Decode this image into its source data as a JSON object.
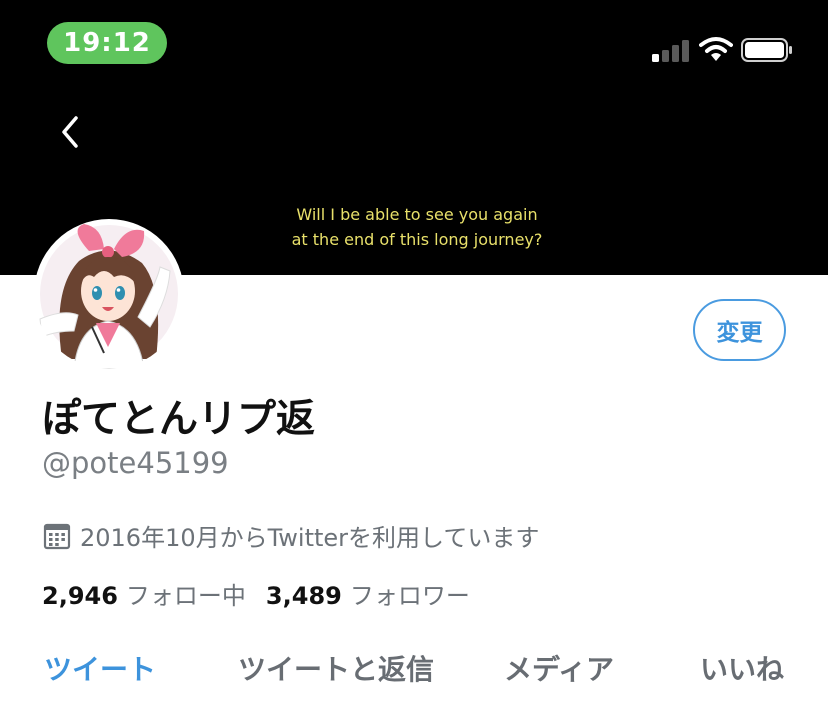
{
  "status_bar": {
    "time": "19:12"
  },
  "header": {
    "subtitle_line1": "Will I be able to see you again",
    "subtitle_line2": "at the end of this long journey?"
  },
  "profile": {
    "edit_label": "変更",
    "name": "ぽてとんリプ返",
    "handle": "@pote45199",
    "joined": "2016年10月からTwitterを利用しています",
    "following_count": "2,946",
    "following_label": "フォロー中",
    "followers_count": "3,489",
    "followers_label": "フォロワー"
  },
  "tabs": [
    {
      "label": "ツイート",
      "active": true
    },
    {
      "label": "ツイートと返信",
      "active": false
    },
    {
      "label": "メディア",
      "active": false
    },
    {
      "label": "いいね",
      "active": false
    }
  ],
  "colors": {
    "accent": "#3d93dc",
    "time_pill": "#5fc55d",
    "subtitle": "#e8e06a"
  }
}
